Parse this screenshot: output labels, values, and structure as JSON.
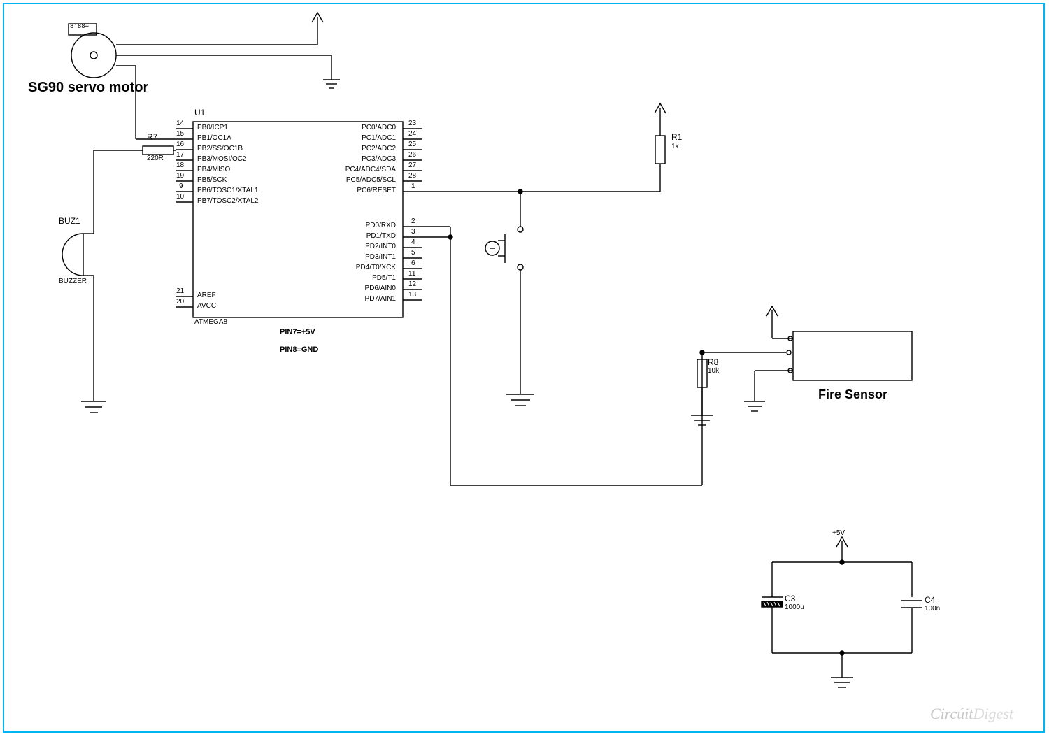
{
  "components": {
    "servo": {
      "title": "SG90 servo motor",
      "display": "8'88+"
    },
    "buzzer_ref": "BUZ1",
    "buzzer_name": "BUZZER",
    "r7_ref": "R7",
    "r7_val": "220R",
    "u1_ref": "U1",
    "u1_part": "ATMEGA8",
    "u1_note1": "PIN7=+5V",
    "u1_note2": "PIN8=GND",
    "r1_ref": "R1",
    "r1_val": "1k",
    "r8_ref": "R8",
    "r8_val": "10k",
    "fire_sensor": "Fire Sensor",
    "c3_ref": "C3",
    "c3_val": "1000u",
    "c4_ref": "C4",
    "c4_val": "100n",
    "pwr_5v": "+5V",
    "watermark1": "Circúit",
    "watermark2": "Digest"
  },
  "u1_pins_left": [
    {
      "num": "14",
      "name": "PB0/ICP1"
    },
    {
      "num": "15",
      "name": "PB1/OC1A"
    },
    {
      "num": "16",
      "name": "PB2/SS/OC1B"
    },
    {
      "num": "17",
      "name": "PB3/MOSI/OC2"
    },
    {
      "num": "18",
      "name": "PB4/MISO"
    },
    {
      "num": "19",
      "name": "PB5/SCK"
    },
    {
      "num": "9",
      "name": "PB6/TOSC1/XTAL1"
    },
    {
      "num": "10",
      "name": "PB7/TOSC2/XTAL2"
    }
  ],
  "u1_pins_left2": [
    {
      "num": "21",
      "name": "AREF"
    },
    {
      "num": "20",
      "name": "AVCC"
    }
  ],
  "u1_pins_right1": [
    {
      "num": "23",
      "name": "PC0/ADC0"
    },
    {
      "num": "24",
      "name": "PC1/ADC1"
    },
    {
      "num": "25",
      "name": "PC2/ADC2"
    },
    {
      "num": "26",
      "name": "PC3/ADC3"
    },
    {
      "num": "27",
      "name": "PC4/ADC4/SDA"
    },
    {
      "num": "28",
      "name": "PC5/ADC5/SCL"
    },
    {
      "num": "1",
      "name": "PC6/RESET"
    }
  ],
  "u1_pins_right2": [
    {
      "num": "2",
      "name": "PD0/RXD"
    },
    {
      "num": "3",
      "name": "PD1/TXD"
    },
    {
      "num": "4",
      "name": "PD2/INT0"
    },
    {
      "num": "5",
      "name": "PD3/INT1"
    },
    {
      "num": "6",
      "name": "PD4/T0/XCK"
    },
    {
      "num": "11",
      "name": "PD5/T1"
    },
    {
      "num": "12",
      "name": "PD6/AIN0"
    },
    {
      "num": "13",
      "name": "PD7/AIN1"
    }
  ]
}
